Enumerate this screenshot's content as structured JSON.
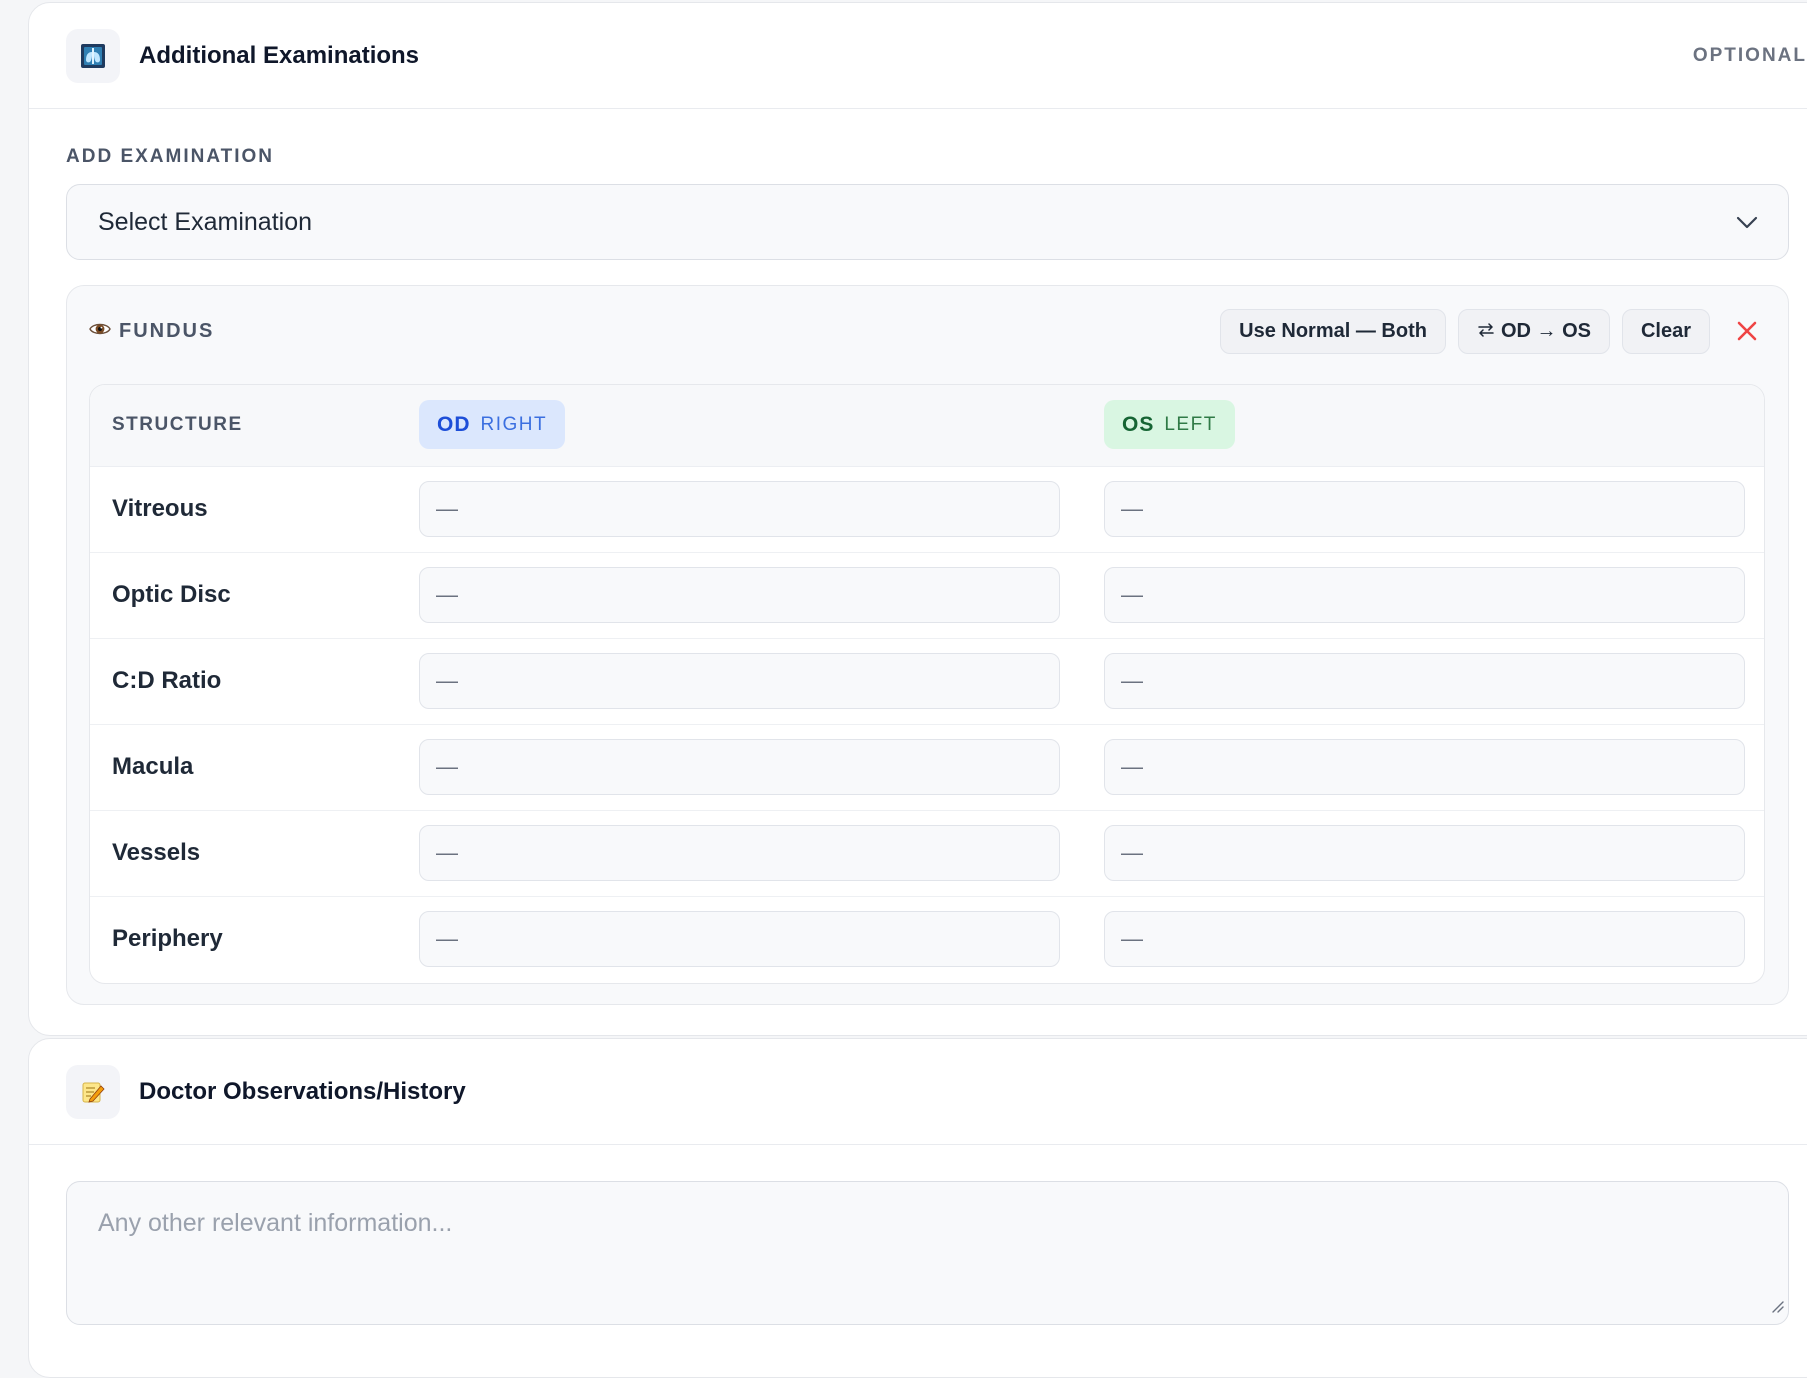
{
  "additional_exams": {
    "title": "Additional Examinations",
    "icon": "x-ray-icon",
    "optional_label": "OPTIONAL",
    "add_label": "ADD EXAMINATION",
    "select_value": "Select Examination"
  },
  "fundus": {
    "title": "FUNDUS",
    "icon": "eye-icon",
    "actions": {
      "use_normal": "Use Normal — Both",
      "copy": "OD → OS",
      "clear": "Clear"
    },
    "table": {
      "structure_header": "STRUCTURE",
      "od": {
        "code": "OD",
        "side": "RIGHT"
      },
      "os": {
        "code": "OS",
        "side": "LEFT"
      },
      "rows": [
        {
          "label": "Vitreous",
          "od": "—",
          "os": "—"
        },
        {
          "label": "Optic Disc",
          "od": "—",
          "os": "—"
        },
        {
          "label": "C:D Ratio",
          "od": "—",
          "os": "—"
        },
        {
          "label": "Macula",
          "od": "—",
          "os": "—"
        },
        {
          "label": "Vessels",
          "od": "—",
          "os": "—"
        },
        {
          "label": "Periphery",
          "od": "—",
          "os": "—"
        }
      ]
    }
  },
  "observations": {
    "title": "Doctor Observations/History",
    "icon": "memo-icon",
    "placeholder": "Any other relevant information..."
  },
  "colors": {
    "od_accent": "#1d4ed8",
    "os_accent": "#166534",
    "close_red": "#ef4444"
  }
}
